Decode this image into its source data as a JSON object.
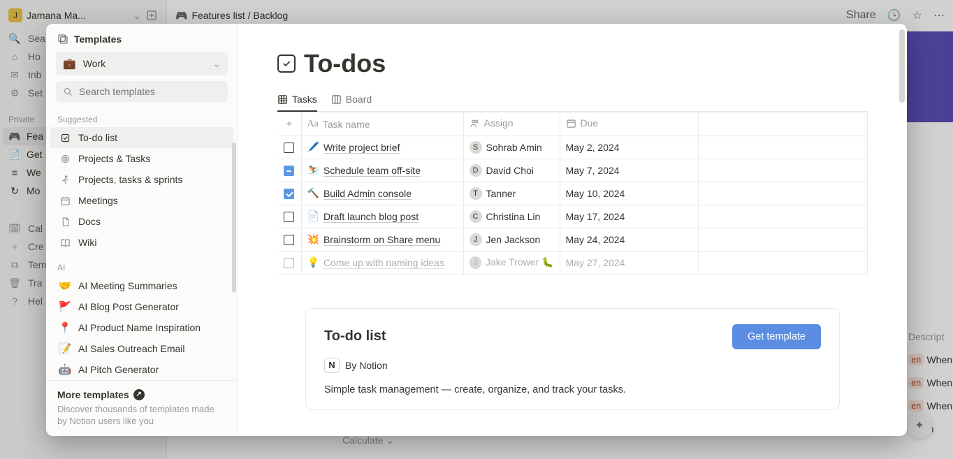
{
  "bg": {
    "workspace_name": "Jamana Ma...",
    "nav": {
      "search": "Sea",
      "home": "Ho",
      "inbox": "Inb",
      "settings": "Set"
    },
    "private_label": "Private",
    "pages": [
      {
        "label": "Fea",
        "emoji": "🎮"
      },
      {
        "label": "Get",
        "emoji": "📄"
      },
      {
        "label": "We",
        "emoji": "≡"
      },
      {
        "label": "Mo",
        "emoji": "↻"
      }
    ],
    "tools": [
      {
        "label": "Cal"
      },
      {
        "label": "Cre"
      },
      {
        "label": "Tem"
      },
      {
        "label": "Tra"
      },
      {
        "label": "Hel"
      }
    ],
    "breadcrumb_emoji": "🎮",
    "breadcrumb": "Features list / Backlog",
    "share": "Share",
    "desc_header": "Descript",
    "when": "When",
    "calculate": "Calculate"
  },
  "modal": {
    "title": "Templates",
    "category_emoji": "💼",
    "category": "Work",
    "search_placeholder": "Search templates",
    "suggested_label": "Suggested",
    "suggested": [
      {
        "label": "To-do list",
        "icon": "check"
      },
      {
        "label": "Projects & Tasks",
        "icon": "target"
      },
      {
        "label": "Projects, tasks & sprints",
        "icon": "run"
      },
      {
        "label": "Meetings",
        "icon": "calendar"
      },
      {
        "label": "Docs",
        "icon": "doc"
      },
      {
        "label": "Wiki",
        "icon": "book"
      }
    ],
    "ai_label": "AI",
    "ai": [
      {
        "emoji": "🤝",
        "label": "AI Meeting Summaries"
      },
      {
        "emoji": "🚩",
        "label": "AI Blog Post Generator"
      },
      {
        "emoji": "📍",
        "label": "AI Product Name Inspiration"
      },
      {
        "emoji": "📝",
        "label": "AI Sales Outreach Email"
      },
      {
        "emoji": "🤖",
        "label": "AI Pitch Generator"
      }
    ],
    "more_title": "More templates",
    "more_sub": "Discover thousands of templates made by Notion users like you"
  },
  "preview": {
    "title": "To-dos",
    "tabs": [
      {
        "label": "Tasks",
        "icon": "table",
        "active": true
      },
      {
        "label": "Board",
        "icon": "board",
        "active": false
      }
    ],
    "columns": {
      "name": "Task name",
      "assign": "Assign",
      "due": "Due"
    },
    "rows": [
      {
        "state": "unchecked",
        "emoji": "🖊️",
        "name": "Write project brief",
        "assign": "Sohrab Amin",
        "due": "May 2, 2024"
      },
      {
        "state": "indet",
        "emoji": "⛷️",
        "name": "Schedule team off-site",
        "assign": "David Choi",
        "due": "May 7, 2024"
      },
      {
        "state": "checked",
        "emoji": "🔨",
        "name": "Build Admin console",
        "assign": "Tanner",
        "due": "May 10, 2024"
      },
      {
        "state": "unchecked",
        "emoji": "📄",
        "name": "Draft launch blog post",
        "assign": "Christina Lin",
        "due": "May 17, 2024"
      },
      {
        "state": "unchecked",
        "emoji": "💥",
        "name": "Brainstorm on Share menu",
        "assign": "Jen Jackson",
        "due": "May 24, 2024"
      },
      {
        "state": "unchecked",
        "emoji": "💡",
        "name": "Come up with naming ideas",
        "assign": "Jake Trower 🐛",
        "due": "May 27, 2024",
        "faded": true
      }
    ],
    "card_title": "To-do list",
    "byline": "By Notion",
    "card_desc": "Simple task management — create, organize, and track your tasks.",
    "get_btn": "Get template"
  }
}
